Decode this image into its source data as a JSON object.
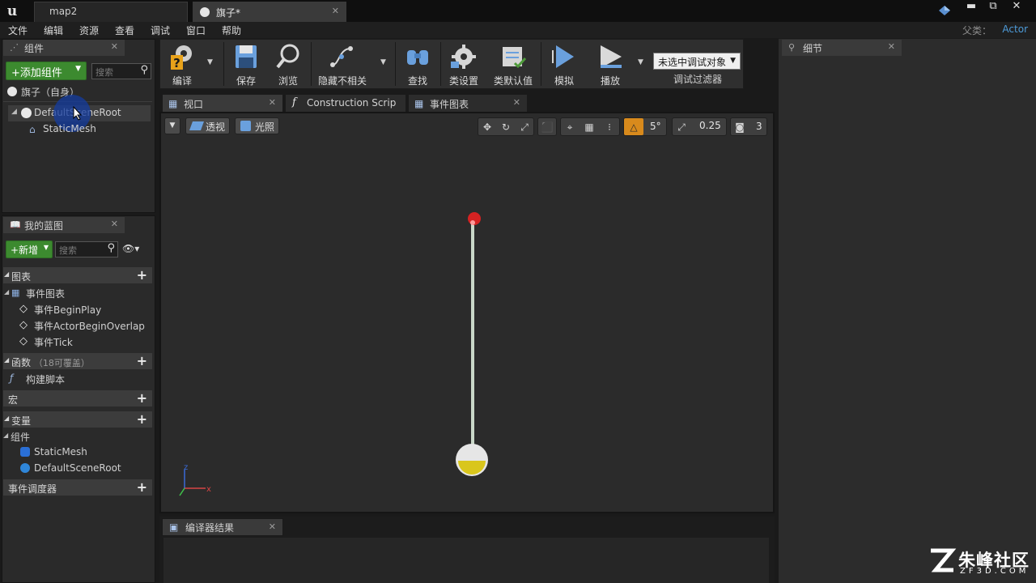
{
  "window": {
    "tabs": [
      {
        "label": "map2"
      },
      {
        "label": "旗子*"
      }
    ],
    "controls": {
      "minimize": "▬",
      "restore": "⧉",
      "close": "✕"
    }
  },
  "menu": {
    "items": [
      "文件",
      "编辑",
      "资源",
      "查看",
      "调试",
      "窗口",
      "帮助"
    ],
    "parent_label": "父类：",
    "parent_value": "Actor"
  },
  "components_panel": {
    "tab_label": "组件",
    "add_button": "+添加组件",
    "search_placeholder": "搜索",
    "self_row": "旗子（自身）",
    "tree": [
      {
        "label": "DefaultSceneRoot"
      },
      {
        "label": "StaticMesh"
      }
    ]
  },
  "blueprint_panel": {
    "tab_label": "我的蓝图",
    "new_button": "+新增",
    "search_placeholder": "搜索",
    "sections": {
      "graphs": "图表",
      "event_graph": "事件图表",
      "events": [
        "事件BeginPlay",
        "事件ActorBeginOverlap",
        "事件Tick"
      ],
      "functions": "函数",
      "functions_note": "（18可覆盖）",
      "construction_script": "构建脚本",
      "macros": "宏",
      "variables": "变量",
      "components": "组件",
      "component_vars": [
        "StaticMesh",
        "DefaultSceneRoot"
      ],
      "dispatchers": "事件调度器"
    }
  },
  "toolbar": {
    "compile": "编译",
    "save": "保存",
    "browse": "浏览",
    "hide_unrelated": "隐藏不相关",
    "find": "查找",
    "class_settings": "类设置",
    "class_defaults": "类默认值",
    "simulate": "模拟",
    "play": "播放",
    "debug_object": "未选中调试对象",
    "debug_filter": "调试过滤器"
  },
  "editor_tabs": [
    {
      "label": "视口"
    },
    {
      "label": "Construction Scrip"
    },
    {
      "label": "事件图表"
    }
  ],
  "viewport": {
    "perspective": "透视",
    "lighting": "光照",
    "grid_snap": "5°",
    "scale_snap": "0.25",
    "camera_speed": "3",
    "axis_x": "x",
    "axis_z": "z"
  },
  "compiler": {
    "tab_label": "编译器结果"
  },
  "details": {
    "tab_label": "细节"
  },
  "watermark": {
    "brand": "朱峰社区",
    "url": "ZF3D.COM"
  },
  "colors": {
    "accent_green": "#3c8a2f",
    "link_blue": "#4d9bd9",
    "flag_ball": "#d42222",
    "base_yellow": "#d9c61c"
  }
}
